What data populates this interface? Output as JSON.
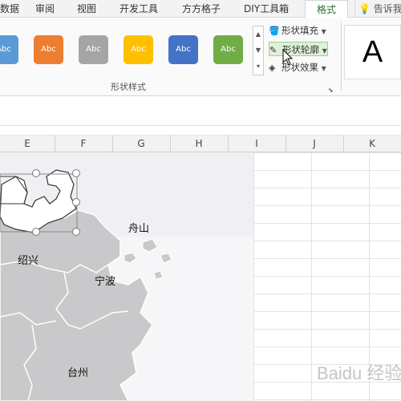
{
  "tabs": [
    {
      "label": "数据"
    },
    {
      "label": "审阅"
    },
    {
      "label": "视图"
    },
    {
      "label": "开发工具"
    },
    {
      "label": "方方格子"
    },
    {
      "label": "DIY工具箱"
    },
    {
      "label": "格式"
    }
  ],
  "tell_me": "告诉我",
  "shape_styles": {
    "swatches": [
      {
        "label": "Abc",
        "color": "#5b9bd5"
      },
      {
        "label": "Abc",
        "color": "#ed7d31"
      },
      {
        "label": "Abc",
        "color": "#a5a5a5"
      },
      {
        "label": "Abc",
        "color": "#ffc000"
      },
      {
        "label": "Abc",
        "color": "#4472c4"
      },
      {
        "label": "Abc",
        "color": "#70ad47"
      }
    ],
    "fill_label": "形状填充",
    "outline_label": "形状轮廓",
    "effects_label": "形状效果",
    "group_label": "形状样式"
  },
  "wordart_preview": "A",
  "columns": [
    "E",
    "F",
    "G",
    "H",
    "I",
    "J",
    "K"
  ],
  "map_labels": {
    "zhoushan": "舟山",
    "shaoxing": "绍兴",
    "ningbo": "宁波",
    "taizhou": "台州"
  },
  "watermark": "Baidu 经验"
}
